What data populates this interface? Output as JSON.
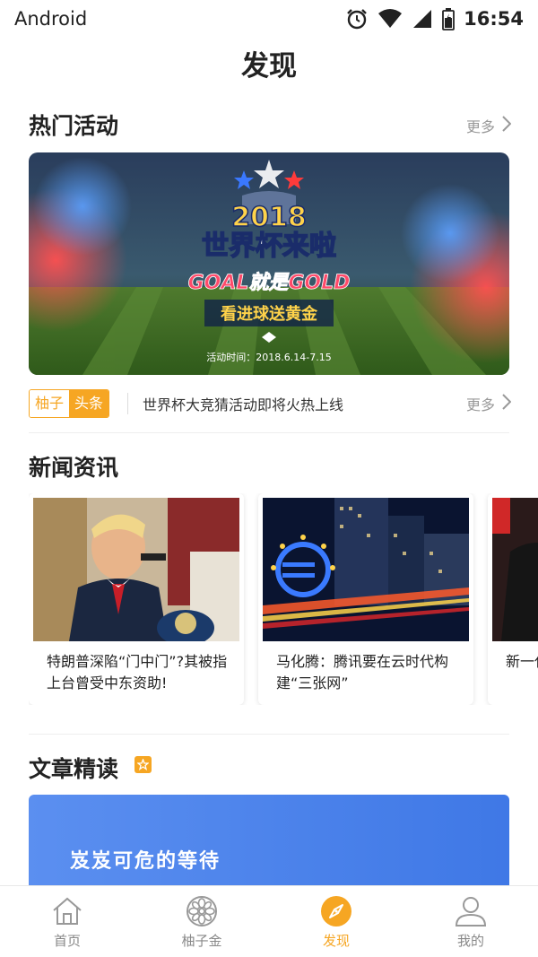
{
  "status_bar": {
    "carrier": "Android",
    "time": "16:54"
  },
  "page": {
    "title": "发现"
  },
  "hot_activities": {
    "title": "热门活动",
    "more_label": "更多",
    "banner": {
      "year": "2018",
      "headline": "世界杯来啦",
      "slogan": "GOAL就是GOLD",
      "subslogan": "看进球送黄金",
      "date": "活动时间：2018.6.14-7.15"
    }
  },
  "ticker": {
    "tag_left": "柚子",
    "tag_right": "头条",
    "text": "世界杯大竞猜活动即将火热上线",
    "more_label": "更多"
  },
  "news": {
    "title": "新闻资讯",
    "items": [
      {
        "caption": "特朗普深陷“门中门”?其被指上台曾受中东资助!"
      },
      {
        "caption": "马化腾：腾讯要在云时代构建“三张网”"
      },
      {
        "caption": "新一代量生产"
      }
    ]
  },
  "articles": {
    "title": "文章精读",
    "items": [
      {
        "title": "岌岌可危的等待"
      }
    ]
  },
  "bottom_nav": {
    "items": [
      {
        "label": "首页",
        "icon": "home-icon"
      },
      {
        "label": "柚子金",
        "icon": "pomelo-icon"
      },
      {
        "label": "发现",
        "icon": "compass-icon"
      },
      {
        "label": "我的",
        "icon": "user-icon"
      }
    ],
    "active_index": 2
  },
  "colors": {
    "accent": "#f6a623",
    "article_blue": "#4a84ec",
    "text_muted": "#999999"
  }
}
